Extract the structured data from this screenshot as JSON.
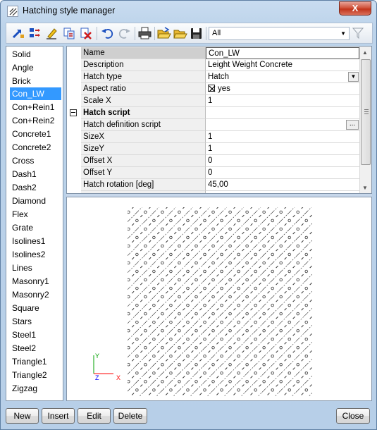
{
  "window": {
    "title": "Hatching style manager",
    "close_label": "X"
  },
  "toolbar": {
    "buttons": [
      "import-icon",
      "export-icon",
      "rename-icon",
      "copy-icon",
      "delete-icon",
      "undo-icon",
      "redo-icon",
      "print-icon",
      "open-icon",
      "open-folder-icon",
      "save-icon"
    ],
    "filter_value": "All"
  },
  "styles": {
    "items": [
      "Solid",
      "Angle",
      "Brick",
      "Con_LW",
      "Con+Rein1",
      "Con+Rein2",
      "Concrete1",
      "Concrete2",
      "Cross",
      "Dash1",
      "Dash2",
      "Diamond",
      "Flex",
      "Grate",
      "Isolines1",
      "Isolines2",
      "Lines",
      "Masonry1",
      "Masonry2",
      "Square",
      "Stars",
      "Steel1",
      "Steel2",
      "Triangle1",
      "Triangle2",
      "Zigzag"
    ],
    "selected": "Con_LW"
  },
  "properties": {
    "rows": [
      {
        "name": "Name",
        "value": "Con_LW"
      },
      {
        "name": "Description",
        "value": "Leight Weight Concrete"
      },
      {
        "name": "Hatch type",
        "value": "Hatch"
      },
      {
        "name": "Aspect ratio",
        "value": "yes"
      },
      {
        "name": "Scale X",
        "value": "1"
      },
      {
        "name": "Hatch script",
        "value": ""
      },
      {
        "name": "Hatch definition script",
        "value": ""
      },
      {
        "name": "SizeX",
        "value": "1"
      },
      {
        "name": "SizeY",
        "value": "1"
      },
      {
        "name": "Offset X",
        "value": "0"
      },
      {
        "name": "Offset Y",
        "value": "0"
      },
      {
        "name": "Hatch rotation [deg]",
        "value": "45,00"
      }
    ],
    "ellipsis_label": "..."
  },
  "preview": {
    "axis_y": "Y",
    "axis_x": "X",
    "axis_z": "Z"
  },
  "buttons": {
    "new": "New",
    "insert": "Insert",
    "edit": "Edit",
    "delete": "Delete",
    "close": "Close"
  },
  "colors": {
    "selection": "#3399ff",
    "axis_x": "#ff0000",
    "axis_y": "#00a000",
    "axis_z": "#0000ff"
  }
}
